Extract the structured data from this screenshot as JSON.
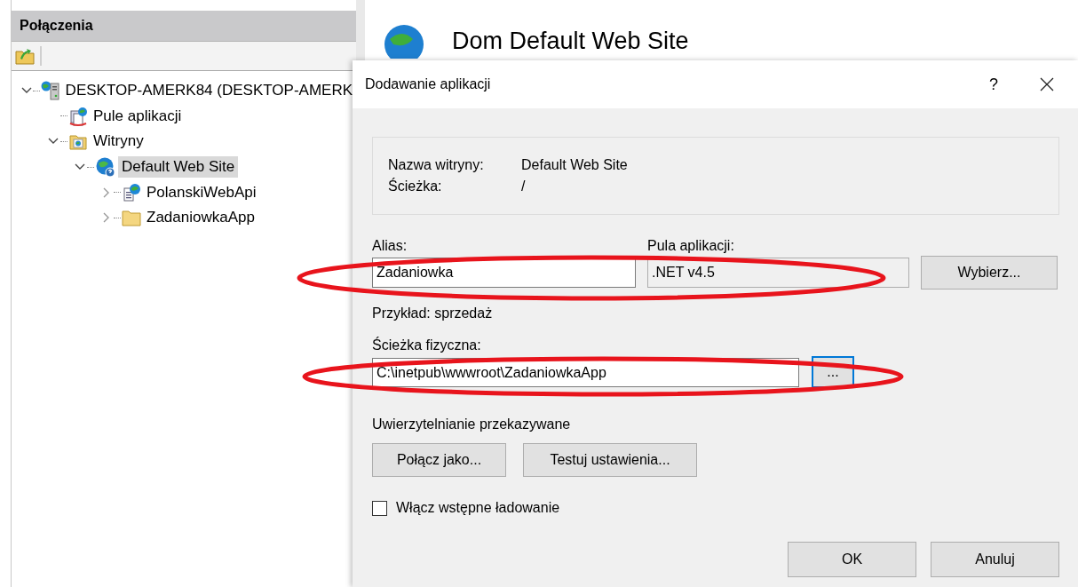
{
  "connections_panel": {
    "title": "Połączenia",
    "tree": [
      {
        "label": "DESKTOP-AMERK84 (DESKTOP-AMERK",
        "kind": "server",
        "expanded": true,
        "selected": false,
        "children": [
          {
            "label": "Pule aplikacji",
            "kind": "app-pools",
            "selected": false
          },
          {
            "label": "Witryny",
            "kind": "sites",
            "expanded": true,
            "selected": false,
            "children": [
              {
                "label": "Default Web Site",
                "kind": "site",
                "expanded": true,
                "selected": true,
                "children": [
                  {
                    "label": "PolanskiWebApi",
                    "kind": "application",
                    "expanded": false,
                    "selected": false
                  },
                  {
                    "label": "ZadaniowkaApp",
                    "kind": "folder",
                    "expanded": false,
                    "selected": false
                  }
                ]
              }
            ]
          }
        ]
      }
    ]
  },
  "main_pane": {
    "title": "Dom Default Web Site"
  },
  "dialog": {
    "title": "Dodawanie aplikacji",
    "help": "?",
    "info": [
      {
        "label": "Nazwa witryny:",
        "value": "Default Web Site"
      },
      {
        "label": "Ścieżka:",
        "value": "/"
      }
    ],
    "alias": {
      "label": "Alias:",
      "value": "Zadaniowka"
    },
    "app_pool": {
      "label": "Pula aplikacji:",
      "value": ".NET v4.5",
      "button": "Wybierz..."
    },
    "example": "Przykład: sprzedaż",
    "physical_path": {
      "label": "Ścieżka fizyczna:",
      "value": "C:\\inetpub\\wwwroot\\ZadaniowkaApp",
      "button": "..."
    },
    "pass_through": {
      "label": "Uwierzytelnianie przekazywane",
      "buttons": [
        "Połącz jako...",
        "Testuj ustawienia..."
      ]
    },
    "preload": {
      "label": "Włącz wstępne ładowanie",
      "checked": false
    },
    "buttons": [
      "OK",
      "Anuluj"
    ]
  }
}
